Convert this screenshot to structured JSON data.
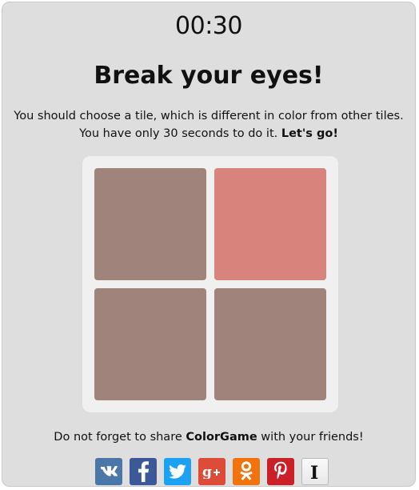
{
  "timer": "00:30",
  "title": "Break your eyes!",
  "description": {
    "line1": "You should choose a tile, which is different in color from other tiles.",
    "line2_prefix": "You have only 30 seconds to do it. ",
    "line2_bold": "Let's go!"
  },
  "tiles": [
    {
      "color": "#a0837b"
    },
    {
      "color": "#d8837c"
    },
    {
      "color": "#a0837b"
    },
    {
      "color": "#a0837b"
    }
  ],
  "share": {
    "prefix": "Do not forget to share ",
    "brand": "ColorGame",
    "suffix": " with your friends!"
  },
  "social_buttons": [
    {
      "icon": "vk-icon",
      "color": "#4a76a8"
    },
    {
      "icon": "facebook-icon",
      "color": "#3b5998"
    },
    {
      "icon": "twitter-icon",
      "color": "#1da1f2"
    },
    {
      "icon": "google-plus-icon",
      "color": "#dd4b39"
    },
    {
      "icon": "odnoklassniki-icon",
      "color": "#f2720c"
    },
    {
      "icon": "pinterest-icon",
      "color": "#cb2027"
    },
    {
      "icon": "instapaper-icon",
      "color": "#e8e8e8"
    }
  ]
}
